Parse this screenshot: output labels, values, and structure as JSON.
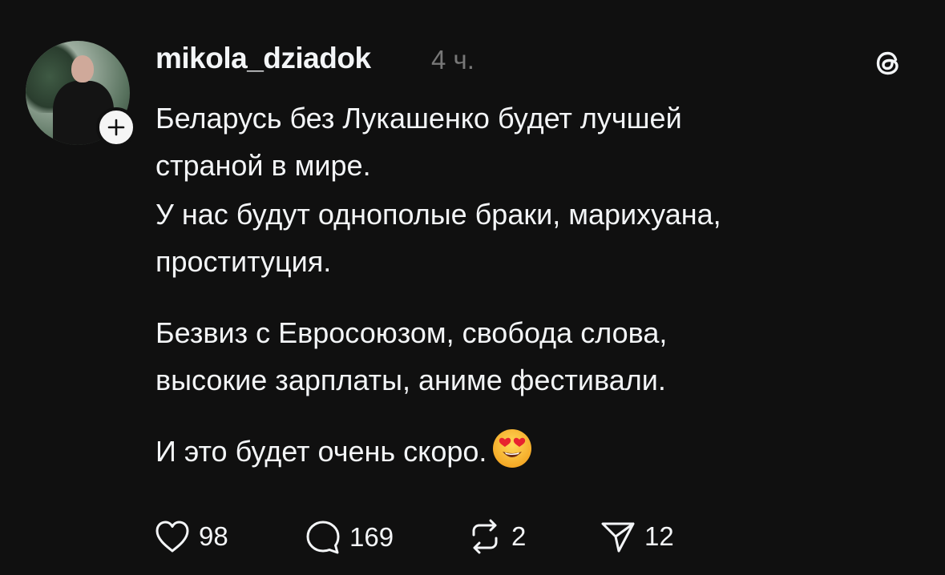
{
  "post": {
    "username": "mikola_dziadok",
    "time": "4 ч.",
    "paragraphs": {
      "p1_line1": "Беларусь без Лукашенко будет лучшей",
      "p1_line2": "страной в мире.",
      "p2_line1": "У нас будут однополые браки, марихуана,",
      "p2_line2": "проституция.",
      "p3_line1": "Безвиз с Евросоюзом, свобода слова,",
      "p3_line2": "высокие зарплаты, аниме фестивали.",
      "p4_line1": "И это будет очень скоро."
    },
    "emoji": "smiling-face-with-heart-eyes",
    "actions": {
      "likes": "98",
      "replies": "169",
      "reposts": "2",
      "shares": "12"
    }
  },
  "icons": {
    "follow": "plus-icon",
    "app": "threads-logo",
    "like": "heart-icon",
    "reply": "speech-bubble-icon",
    "repost": "repost-icon",
    "share": "send-icon"
  },
  "colors": {
    "background": "#101010",
    "text": "#f3f5f7",
    "secondary": "#777777"
  }
}
